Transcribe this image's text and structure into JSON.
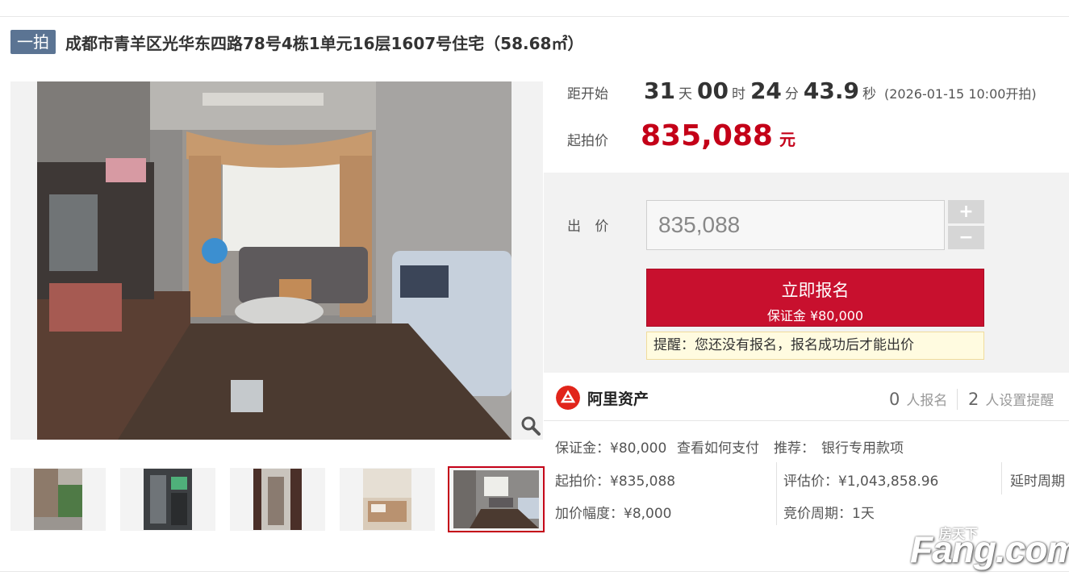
{
  "header": {
    "round_badge": "一拍",
    "lot_title": "成都市青羊区光华东四路78号4栋1单元16层1607号住宅（58.68㎡）"
  },
  "gallery": {
    "zoom_icon": "magnifier-icon",
    "thumbnail_count": 5,
    "active_thumbnail": 5
  },
  "countdown": {
    "label": "距开始",
    "days": "31",
    "days_unit": "天",
    "hours": "00",
    "hours_unit": "时",
    "minutes": "24",
    "minutes_unit": "分",
    "seconds": "43.9",
    "seconds_unit": "秒",
    "start_note": "(2026-01-15 10:00开拍)"
  },
  "start_price": {
    "label": "起拍价",
    "value": "835,088",
    "unit": "元",
    "color": "#c40018"
  },
  "bid": {
    "label": "出 价",
    "input_value": "835,088",
    "plus": "+",
    "minus": "−",
    "signup_label": "立即报名",
    "deposit_label": "保证金 ¥80,000",
    "reminder": "提醒：您还没有报名，报名成功后才能出价",
    "button_color": "#c8102e"
  },
  "platform": {
    "name": "阿里资产",
    "logo_icon": "ali-asset-logo-icon",
    "signup_count": "0",
    "signup_text": "人报名",
    "reminder_count": "2",
    "reminder_text": "人设置提醒"
  },
  "details": {
    "deposit": "保证金：¥80,000",
    "how_to_pay": "查看如何支付",
    "recommend_label": "推荐：",
    "recommend_link": "银行专用款项",
    "start_price": "起拍价：¥835,088",
    "appraisal": "评估价：¥1,043,858.96",
    "extension": "延时周期",
    "increment": "加价幅度：¥8,000",
    "bid_cycle": "竞价周期：1天"
  },
  "watermark": {
    "brand": "Fang.com",
    "cn": "房天下"
  }
}
